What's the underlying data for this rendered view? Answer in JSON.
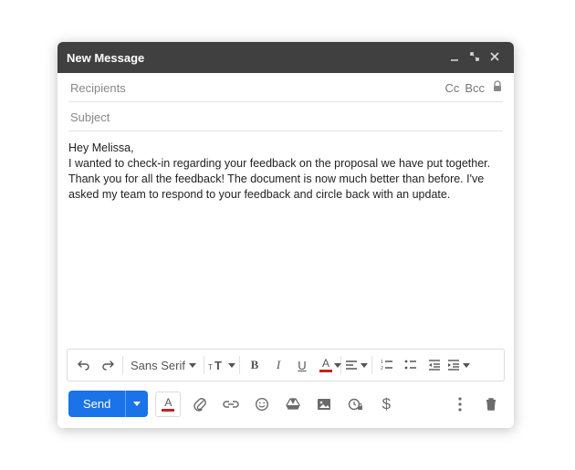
{
  "window": {
    "title": "New Message"
  },
  "fields": {
    "recipients_placeholder": "Recipients",
    "recipients_value": "",
    "cc_label": "Cc",
    "bcc_label": "Bcc",
    "subject_placeholder": "Subject",
    "subject_value": ""
  },
  "body": "Hey Melissa,\nI wanted to check-in regarding your feedback on the proposal we have put together. Thank you for all the feedback! The document is now much better than before. I've asked my team to respond to your feedback and circle back with an update.",
  "format_toolbar": {
    "font_family": "Sans Serif"
  },
  "actions": {
    "send_label": "Send"
  }
}
